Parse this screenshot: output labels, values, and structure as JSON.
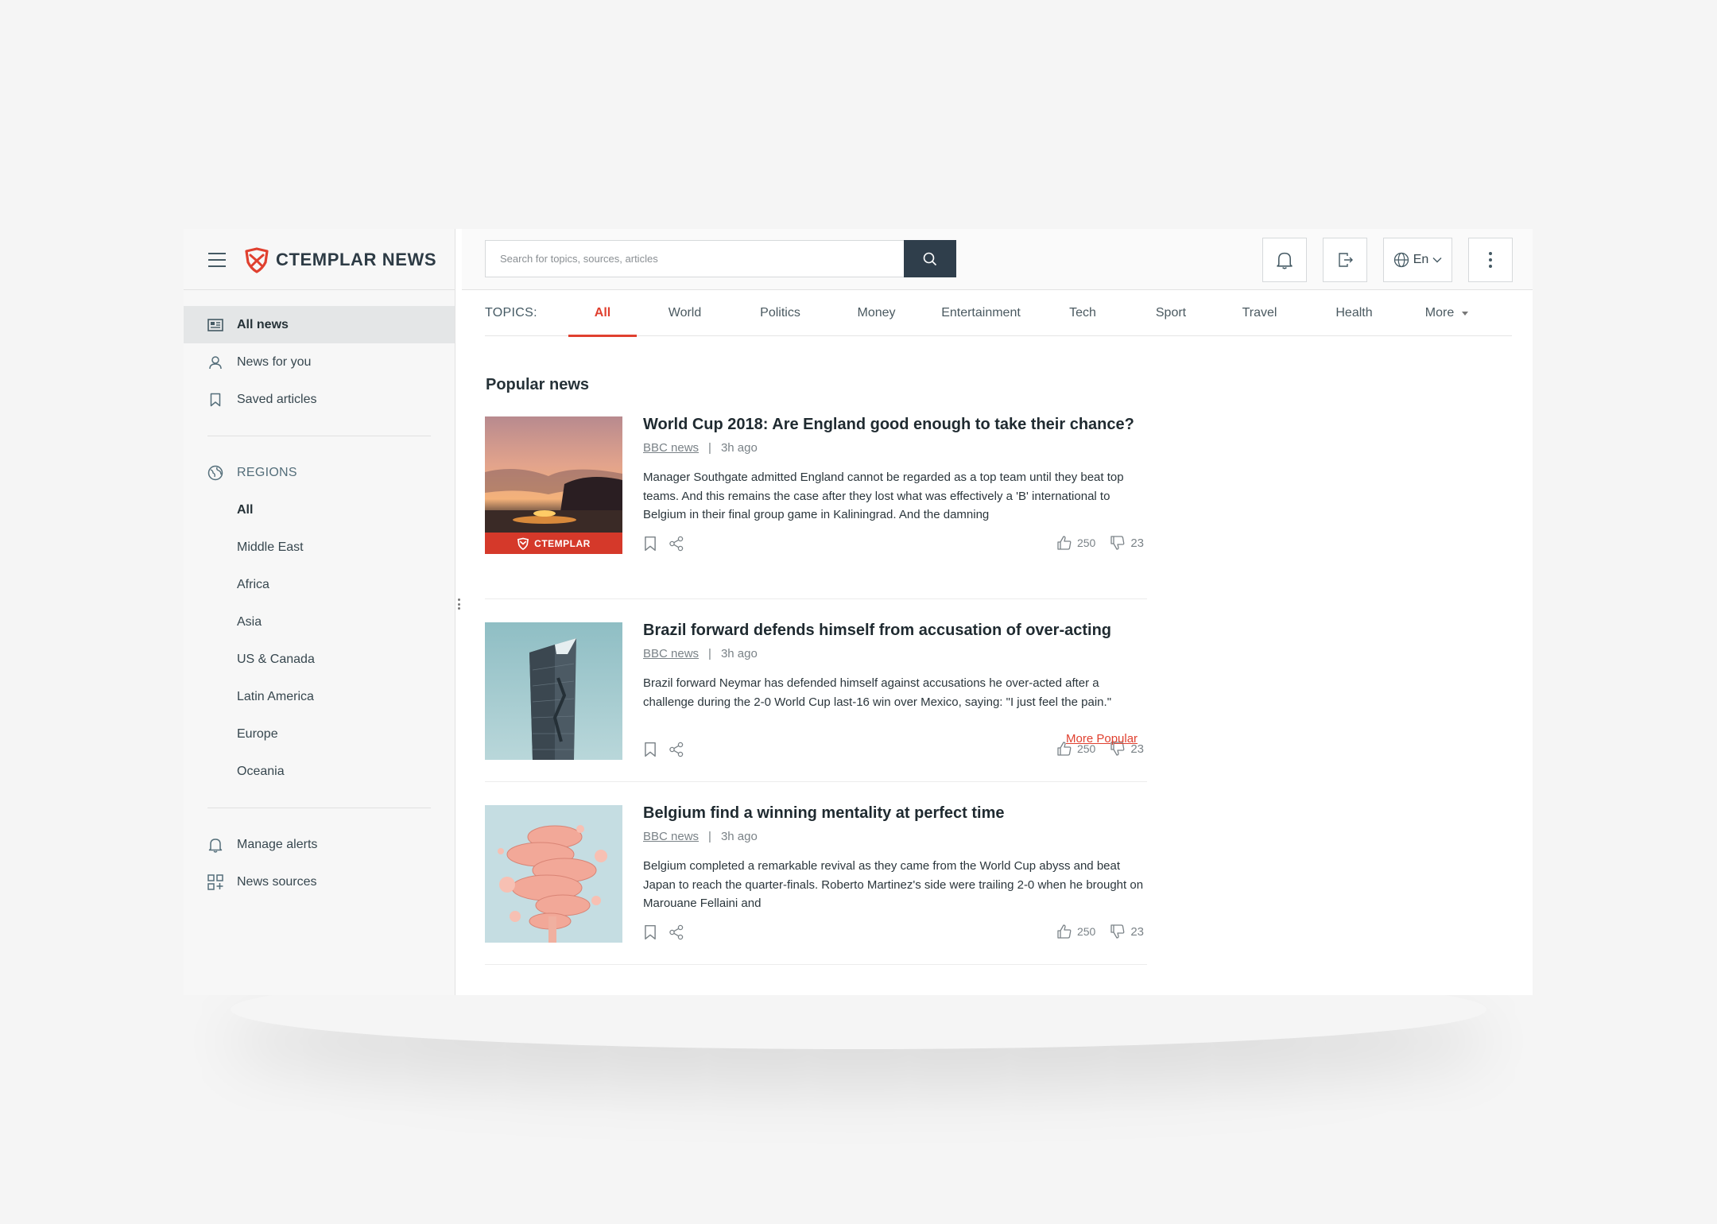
{
  "app": {
    "brand": "CTEMPLAR NEWS",
    "accent": "#e0402f",
    "dark": "#2f3e4b"
  },
  "sidebar": {
    "nav": [
      {
        "label": "All news",
        "icon": "newspaper-icon",
        "active": true
      },
      {
        "label": "News for you",
        "icon": "user-icon",
        "active": false
      },
      {
        "label": "Saved articles",
        "icon": "bookmark-icon",
        "active": false
      }
    ],
    "regions_label": "REGIONS",
    "regions": [
      "All",
      "Middle East",
      "Africa",
      "Asia",
      "US & Canada",
      "Latin America",
      "Europe",
      "Oceania"
    ],
    "bottom": [
      {
        "label": "Manage alerts",
        "icon": "bell-icon"
      },
      {
        "label": "News sources",
        "icon": "grid-add-icon"
      }
    ]
  },
  "topbar": {
    "search_placeholder": "Search for topics, sources, articles",
    "language": "En"
  },
  "topics": {
    "label": "TOPICS:",
    "items": [
      "All",
      "World",
      "Politics",
      "Money",
      "Entertainment",
      "Tech",
      "Sport",
      "Travel",
      "Health",
      "More"
    ],
    "active": "All"
  },
  "main": {
    "section_title": "Popular news",
    "more_link": "More Popular",
    "articles": [
      {
        "title": "World Cup 2018: Are England good enough to take their chance?",
        "source": "BBC news",
        "time": "3h ago",
        "body": "Manager Southgate admitted England cannot be regarded as a top team until they beat top teams. And this remains the case after they lost what was effectively a 'B' international to Belgium in their final group game in Kaliningrad. And the damning",
        "likes": "250",
        "dislikes": "23",
        "badge": "CTEMPLAR"
      },
      {
        "title": "Brazil forward defends himself from accusation of over-acting",
        "source": "BBC news",
        "time": "3h ago",
        "body": "Brazil forward Neymar has defended himself against accusations he over-acted after a challenge during the 2-0 World Cup last-16 win over Mexico, saying: \"I just feel the pain.\"",
        "likes": "250",
        "dislikes": "23"
      },
      {
        "title": "Belgium find a winning mentality at perfect time",
        "source": "BBC news",
        "time": "3h ago",
        "body": "Belgium completed a remarkable revival as they came from the World Cup abyss and beat Japan to reach the quarter-finals. Roberto Martinez's side were trailing 2-0 when he brought on Marouane Fellaini and",
        "likes": "250",
        "dislikes": "23"
      }
    ]
  }
}
